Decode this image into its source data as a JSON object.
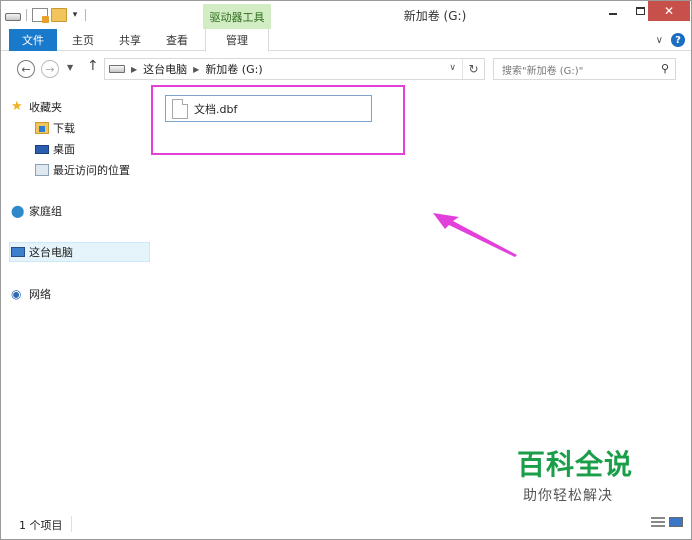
{
  "window": {
    "title": "新加卷 (G:)",
    "context_tab_group": "驱动器工具"
  },
  "ribbon": {
    "tabs": [
      "文件",
      "主页",
      "共享",
      "查看",
      "管理"
    ]
  },
  "address": {
    "breadcrumb": [
      "这台电脑",
      "新加卷 (G:)"
    ],
    "search_placeholder": "搜索\"新加卷 (G:)\""
  },
  "nav_pane": {
    "favorites": "收藏夹",
    "downloads": "下载",
    "desktop": "桌面",
    "recent": "最近访问的位置",
    "homegroup": "家庭组",
    "this_pc": "这台电脑",
    "network": "网络"
  },
  "files": [
    {
      "name": "文档.dbf"
    }
  ],
  "status": {
    "item_count": "1 个项目"
  },
  "watermark": {
    "main": "百科全说",
    "sub": "助你轻松解决"
  },
  "annotation": {
    "color": "#e23fdb"
  }
}
